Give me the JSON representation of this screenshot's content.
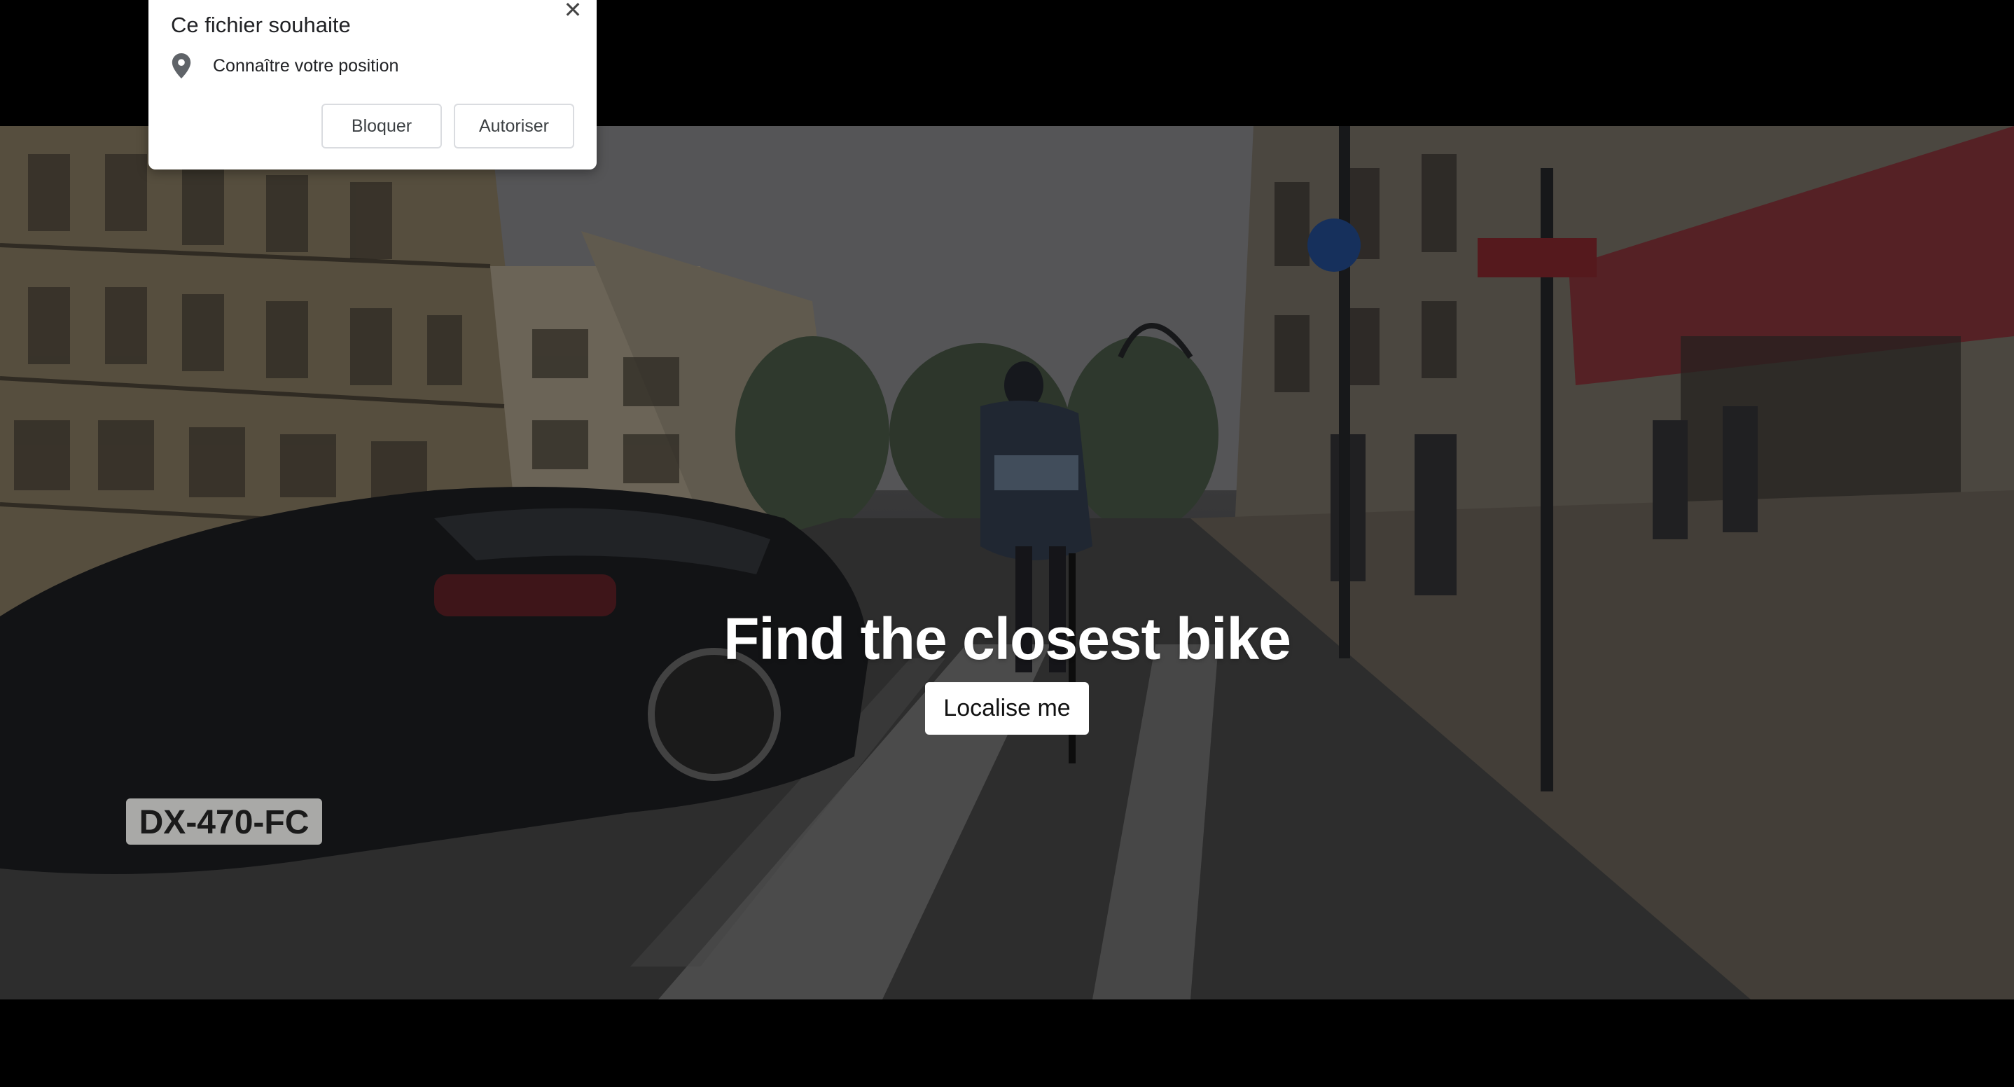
{
  "permission_prompt": {
    "title": "Ce fichier souhaite",
    "permission_label": "Connaître votre position",
    "block_label": "Bloquer",
    "allow_label": "Autoriser",
    "close_glyph": "✕",
    "location_icon": "location-pin-icon"
  },
  "hero": {
    "title": "Find the closest bike",
    "button_label": "Localise me"
  },
  "colors": {
    "page_background": "#000000",
    "hero_text": "#ffffff",
    "button_background": "#ffffff",
    "prompt_background": "#ffffff"
  }
}
